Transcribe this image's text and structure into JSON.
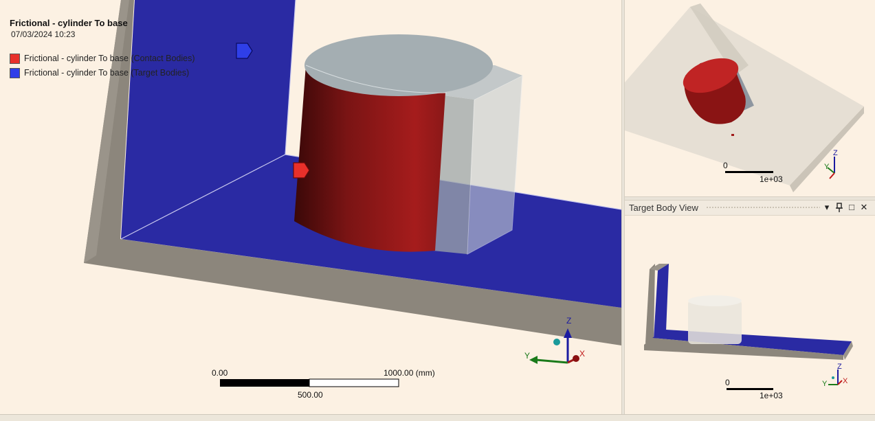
{
  "legend": {
    "title": "Frictional - cylinder To base",
    "date": "07/03/2024 10:23",
    "items": [
      {
        "label": "Frictional - cylinder To base (Contact Bodies)",
        "color": "#e8302a"
      },
      {
        "label": "Frictional - cylinder To base (Target Bodies)",
        "color": "#2f3fe8"
      }
    ]
  },
  "scale_bar": {
    "left_label": "0.00",
    "right_label": "1000.00 (mm)",
    "mid_label": "500.00"
  },
  "triad": {
    "x": "X",
    "y": "Y",
    "z": "Z"
  },
  "contact_view": {
    "scale_left": "0",
    "scale_right": "1e+03"
  },
  "target_view": {
    "title": "Target Body View",
    "scale_left": "0",
    "scale_right": "1e+03",
    "buttons": {
      "dropdown": "▾",
      "pin": "📌",
      "maximize": "□",
      "close": "✕"
    }
  },
  "colors": {
    "contact": "#9e1e1e",
    "target": "#2a2aa3",
    "frame": "#8c867c",
    "background": "#fcf1e3"
  }
}
